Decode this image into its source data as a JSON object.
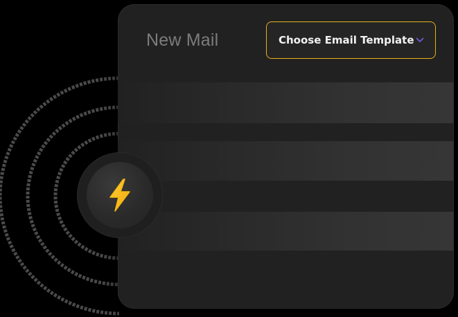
{
  "mail": {
    "title": "New Mail",
    "template_button": {
      "label": "Choose Email Template",
      "icon": "chevron-down-icon"
    }
  },
  "badge": {
    "icon": "lightning-bolt-icon"
  },
  "colors": {
    "background": "#000000",
    "card": "#212121",
    "button_border": "#e8b21f",
    "chevron": "#6b5bd6",
    "bolt": "#f7b90f",
    "title_text": "#7c7c7c"
  }
}
